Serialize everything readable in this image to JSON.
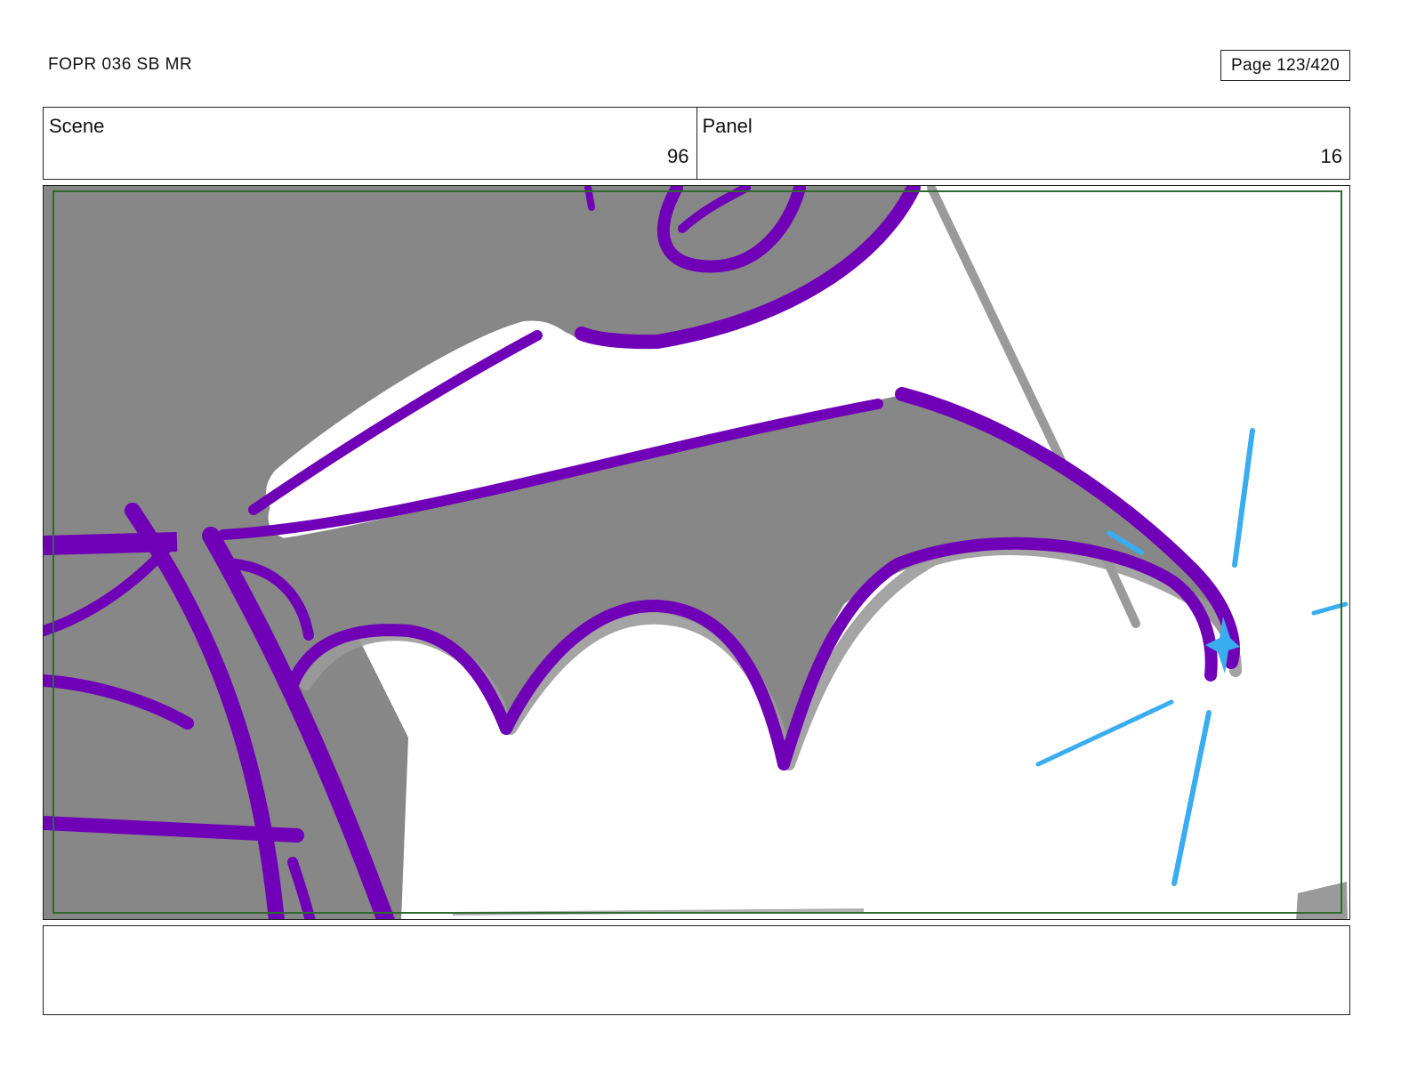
{
  "header": {
    "document_title": "FOPR 036 SB MR",
    "page_indicator": "Page 123/420"
  },
  "info": {
    "scene_label": "Scene",
    "scene_value": "96",
    "panel_label": "Panel",
    "panel_value": "16"
  },
  "artwork": {
    "colors": {
      "fill_gray": "#878787",
      "outline_purple": "#7000b8",
      "highlight_blue": "#3aacf0",
      "safe_frame_green": "#2e6b2e",
      "shadow_gray": "#9a9a9a"
    }
  },
  "notes": {
    "text": ""
  }
}
